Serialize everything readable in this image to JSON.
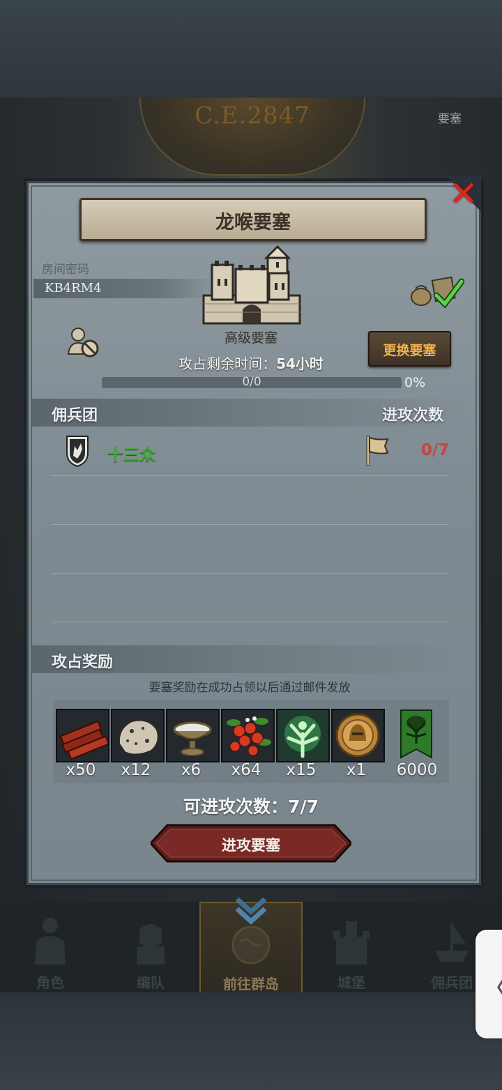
{
  "background": {
    "era": "C.E.2847",
    "fortress_label": "要塞"
  },
  "panel": {
    "title": "龙喉要塞",
    "room": {
      "label": "房间密码",
      "code": "KB4RM4"
    },
    "fortress_type": "高级要塞",
    "timer": {
      "label": "攻占剩余时间：",
      "value": "54小时"
    },
    "swap_button": "更换要塞",
    "progress": {
      "count": "0/0",
      "percent": "0%",
      "fraction": 0
    },
    "mercenary_section": {
      "title": "佣兵团",
      "attack_header": "进攻次数"
    },
    "guilds": [
      {
        "name": "十三众",
        "attacks": "0/7"
      }
    ],
    "reward_section": {
      "title": "攻占奖励",
      "note": "要塞奖励在成功占领以后通过邮件发放"
    },
    "rewards": [
      {
        "icon": "wood-planks-icon",
        "qty": "x50"
      },
      {
        "icon": "ore-icon",
        "qty": "x12"
      },
      {
        "icon": "silver-bowl-icon",
        "qty": "x6"
      },
      {
        "icon": "berries-icon",
        "qty": "x64"
      },
      {
        "icon": "spirit-tree-icon",
        "qty": "x15"
      },
      {
        "icon": "knight-medal-icon",
        "qty": "x1"
      },
      {
        "icon": "guild-banner-icon",
        "qty": "6000"
      }
    ],
    "attempts": {
      "label": "可进攻次数：",
      "value": "7/7"
    },
    "attack_button": "进攻要塞"
  },
  "nav": {
    "items": [
      {
        "label": "角色",
        "icon": "character-icon"
      },
      {
        "label": "编队",
        "icon": "formation-icon"
      },
      {
        "label": "前往群岛",
        "icon": "islands-globe-icon"
      },
      {
        "label": "城堡",
        "icon": "castle-icon"
      },
      {
        "label": "佣兵团",
        "icon": "mercenary-ship-icon"
      }
    ],
    "active_index": 2
  },
  "side_handle_glyph": "〈",
  "close_glyph": "✕"
}
